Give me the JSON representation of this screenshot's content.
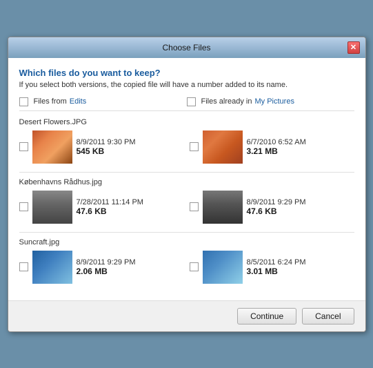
{
  "window": {
    "title": "Choose Files",
    "close_label": "✕"
  },
  "header": {
    "question": "Which files do you want to keep?",
    "subtitle": "If you select both versions, the copied file will have a number added to its name."
  },
  "columns": {
    "left_prefix": "Files from ",
    "left_link": "Edits",
    "right_prefix": "Files already in ",
    "right_link": "My Pictures"
  },
  "files": [
    {
      "name": "Desert Flowers.JPG",
      "left": {
        "date": "8/9/2011 9:30 PM",
        "size": "545 KB"
      },
      "right": {
        "date": "6/7/2010 6:52 AM",
        "size": "3.21 MB"
      }
    },
    {
      "name": "Københavns Rådhus.jpg",
      "left": {
        "date": "7/28/2011 11:14 PM",
        "size": "47.6 KB"
      },
      "right": {
        "date": "8/9/2011 9:29 PM",
        "size": "47.6 KB"
      }
    },
    {
      "name": "Suncraft.jpg",
      "left": {
        "date": "8/9/2011 9:29 PM",
        "size": "2.06 MB"
      },
      "right": {
        "date": "8/5/2011 6:24 PM",
        "size": "3.01 MB"
      }
    }
  ],
  "buttons": {
    "continue": "Continue",
    "cancel": "Cancel"
  }
}
